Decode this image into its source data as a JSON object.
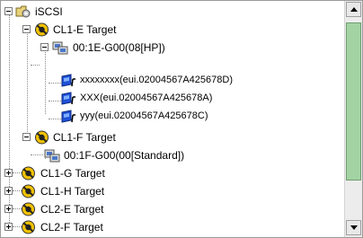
{
  "tree": {
    "root": {
      "label": "iSCSI",
      "icon": "folder-gear-icon"
    },
    "targets": [
      {
        "label": "CL1-E Target",
        "icon": "target-icon"
      },
      {
        "label": "CL1-F Target",
        "icon": "target-icon"
      },
      {
        "label": "CL1-G Target",
        "icon": "target-icon"
      },
      {
        "label": "CL1-H Target",
        "icon": "target-icon"
      },
      {
        "label": "CL2-E Target",
        "icon": "target-icon"
      },
      {
        "label": "CL2-F Target",
        "icon": "target-icon"
      }
    ],
    "host_groups": [
      {
        "label": "00:1E-G00(08[HP])",
        "icon": "host-group-icon"
      },
      {
        "label": "00:1F-G00(00[Standard])",
        "icon": "host-group-icon"
      }
    ],
    "initiators": [
      {
        "label": "xxxxxxxx(eui.02004567A425678D)",
        "icon": "iscsi-initiator-icon"
      },
      {
        "label": "XXX(eui.02004567A425678A)",
        "icon": "iscsi-initiator-icon"
      },
      {
        "label": "yyy(eui.02004567A425678C)",
        "icon": "iscsi-initiator-icon"
      }
    ]
  },
  "colors": {
    "scroll_thumb": "#a3d3a3",
    "target_icon": "#f2c200",
    "initiator_icon": "#1f4fd6"
  }
}
